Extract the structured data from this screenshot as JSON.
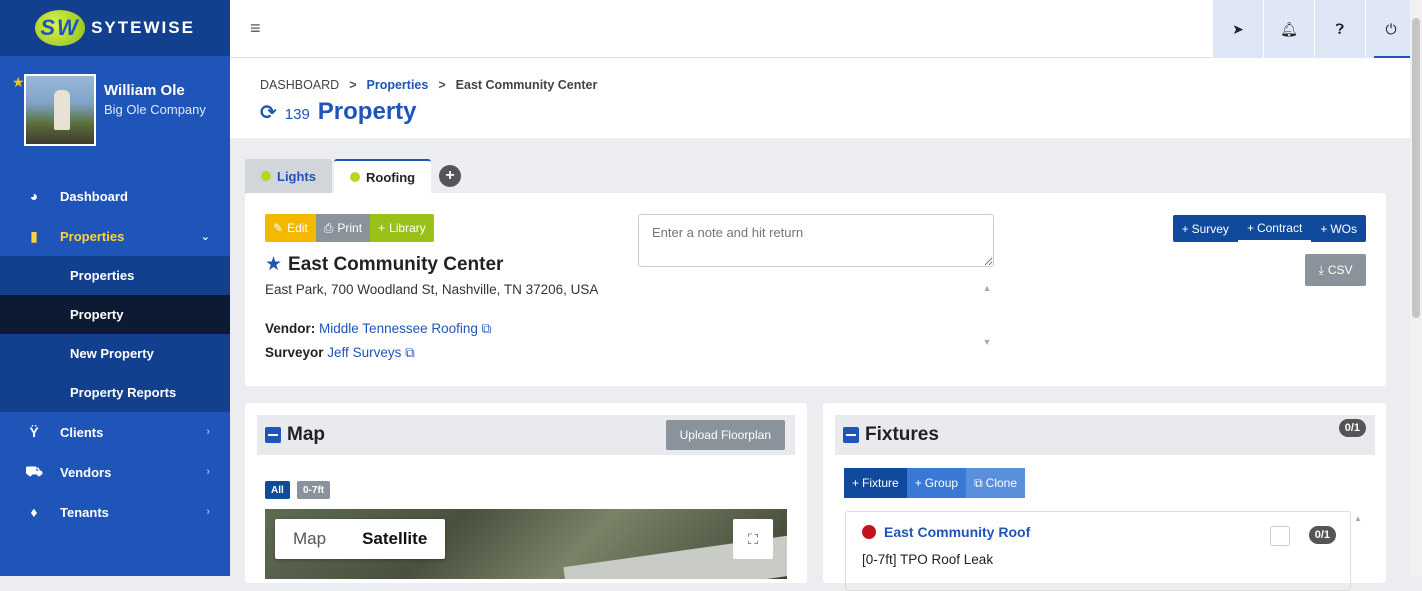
{
  "brand": {
    "name": "SYTEWISE",
    "mark": "SW"
  },
  "user": {
    "name": "William Ole",
    "company": "Big Ole Company"
  },
  "nav": {
    "dashboard": "Dashboard",
    "properties": "Properties",
    "sub": [
      "Properties",
      "Property",
      "New Property",
      "Property Reports"
    ],
    "clients": "Clients",
    "vendors": "Vendors",
    "tenants": "Tenants"
  },
  "breadcrumb": {
    "home": "DASHBOARD",
    "section": "Properties",
    "current": "East Community Center",
    "separator": ">"
  },
  "page": {
    "count": "139",
    "title": "Property"
  },
  "tabs": {
    "lights": "Lights",
    "roofing": "Roofing"
  },
  "property": {
    "edit": "Edit",
    "print": "Print",
    "library": "Library",
    "name": "East Community Center",
    "address": "East Park, 700 Woodland St, Nashville, TN 37206, USA",
    "vendor_label": "Vendor:",
    "vendor": "Middle Tennessee Roofing",
    "surveyor_label": "Surveyor",
    "surveyor": "Jeff Surveys",
    "note_placeholder": "Enter a note and hit return",
    "survey_btn": "Survey",
    "contract_btn": "Contract",
    "wos_btn": "WOs",
    "csv_btn": "CSV"
  },
  "map": {
    "title": "Map",
    "upload": "Upload Floorplan",
    "filter_all": "All",
    "filter_range": "0-7ft",
    "toggle_map": "Map",
    "toggle_sat": "Satellite"
  },
  "fixtures": {
    "title": "Fixtures",
    "count": "0/1",
    "add_fixture": "Fixture",
    "add_group": "Group",
    "clone": "Clone",
    "item_name": "East Community Roof",
    "item_count": "0/1",
    "item_desc": "[0-7ft] TPO Roof Leak"
  },
  "colors": {
    "primary": "#1f55b8",
    "dark": "#133f8f",
    "accent_yellow": "#ffd43b",
    "status_red": "#c4131c",
    "green": "#9ac01a"
  }
}
